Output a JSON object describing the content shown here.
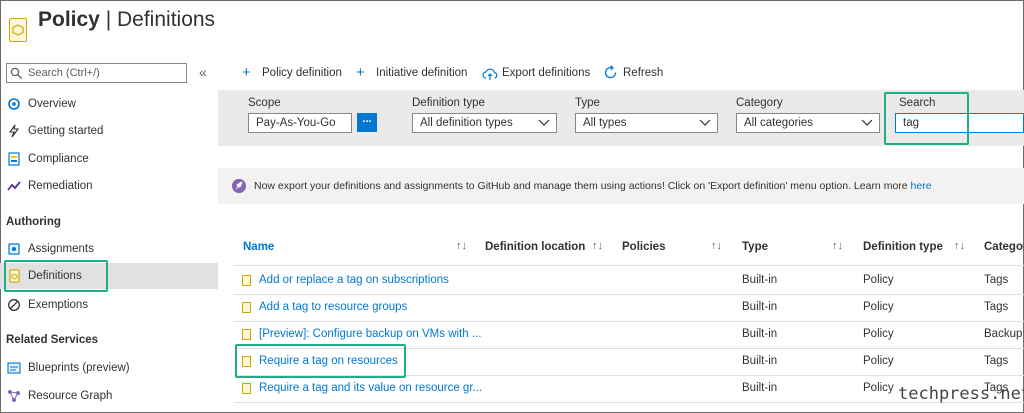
{
  "header": {
    "title_main": "Policy",
    "title_sep": " | ",
    "title_sub": "Definitions",
    "logo_icon": "policy-icon"
  },
  "sidebar": {
    "search_placeholder": "Search (Ctrl+/)",
    "collapse_glyph": "«",
    "items_top": [
      {
        "label": "Overview",
        "icon": "overview-icon"
      },
      {
        "label": "Getting started",
        "icon": "lightning-icon"
      },
      {
        "label": "Compliance",
        "icon": "compliance-icon"
      },
      {
        "label": "Remediation",
        "icon": "remediation-icon"
      }
    ],
    "authoring_head": "Authoring",
    "authoring_items": [
      {
        "label": "Assignments",
        "icon": "assignments-icon"
      },
      {
        "label": "Definitions",
        "icon": "definitions-icon",
        "selected": true
      },
      {
        "label": "Exemptions",
        "icon": "exemptions-icon"
      }
    ],
    "related_head": "Related Services",
    "related_items": [
      {
        "label": "Blueprints (preview)",
        "icon": "blueprints-icon"
      },
      {
        "label": "Resource Graph",
        "icon": "resource-graph-icon"
      }
    ]
  },
  "toolbar": {
    "policy_definition": "Policy definition",
    "initiative_definition": "Initiative definition",
    "export_definitions": "Export definitions",
    "refresh": "Refresh"
  },
  "filters": {
    "scope_label": "Scope",
    "scope_value": "Pay-As-You-Go",
    "scope_button": "...",
    "definition_type_label": "Definition type",
    "definition_type_value": "All definition types",
    "type_label": "Type",
    "type_value": "All types",
    "category_label": "Category",
    "category_value": "All categories",
    "search_label": "Search",
    "search_value": "tag"
  },
  "banner": {
    "text": "Now export your definitions and assignments to GitHub and manage them using actions! Click on 'Export definition' menu option. Learn more",
    "link": "here"
  },
  "table": {
    "headers": {
      "name": "Name",
      "definition_location": "Definition location",
      "policies": "Policies",
      "type": "Type",
      "definition_type": "Definition type",
      "category": "Categor"
    },
    "sort_glyph": "↑↓",
    "rows": [
      {
        "name": "Add or replace a tag on subscriptions",
        "type": "Built-in",
        "definition_type": "Policy",
        "category": "Tags"
      },
      {
        "name": "Add a tag to resource groups",
        "type": "Built-in",
        "definition_type": "Policy",
        "category": "Tags"
      },
      {
        "name": "[Preview]: Configure backup on VMs with ...",
        "type": "Built-in",
        "definition_type": "Policy",
        "category": "Backup"
      },
      {
        "name": "Require a tag on resources",
        "type": "Built-in",
        "definition_type": "Policy",
        "category": "Tags"
      },
      {
        "name": "Require a tag and its value on resource gr...",
        "type": "Built-in",
        "definition_type": "Policy",
        "category": "Tags"
      }
    ]
  },
  "watermark": "techpress.net",
  "colors": {
    "accent": "#0078d4",
    "highlight": "#1fae8a",
    "filter_bg": "#eaeaea"
  }
}
